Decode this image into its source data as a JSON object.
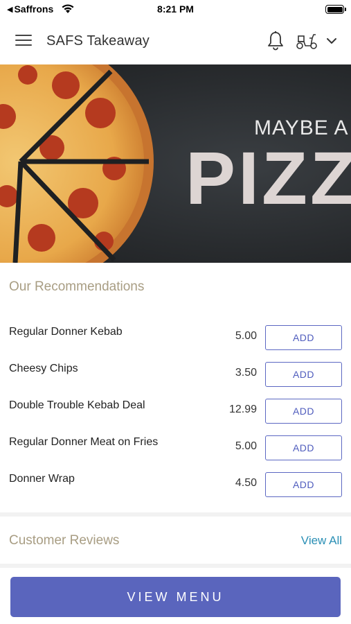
{
  "status_bar": {
    "back_app": "Saffrons",
    "time": "8:21 PM"
  },
  "header": {
    "title": "SAFS Takeaway",
    "icons": [
      "menu-icon",
      "bell-icon",
      "scooter-icon",
      "chevron-down-icon"
    ]
  },
  "hero": {
    "line1": "MAYBE A",
    "line2": "PIZZ"
  },
  "recommendations": {
    "title": "Our Recommendations",
    "add_label": "ADD",
    "items": [
      {
        "name": "Regular Donner Kebab",
        "price": "5.00"
      },
      {
        "name": "Cheesy Chips",
        "price": "3.50"
      },
      {
        "name": "Double Trouble Kebab Deal",
        "price": "12.99"
      },
      {
        "name": "Regular Donner Meat on Fries",
        "price": "5.00"
      },
      {
        "name": "Donner Wrap",
        "price": "4.50"
      }
    ]
  },
  "reviews": {
    "title": "Customer Reviews",
    "view_all": "View All"
  },
  "bottom": {
    "view_menu": "VIEW MENU"
  },
  "colors": {
    "accent": "#5a65bd",
    "section_title": "#a89d83",
    "link": "#2a8fb5"
  }
}
